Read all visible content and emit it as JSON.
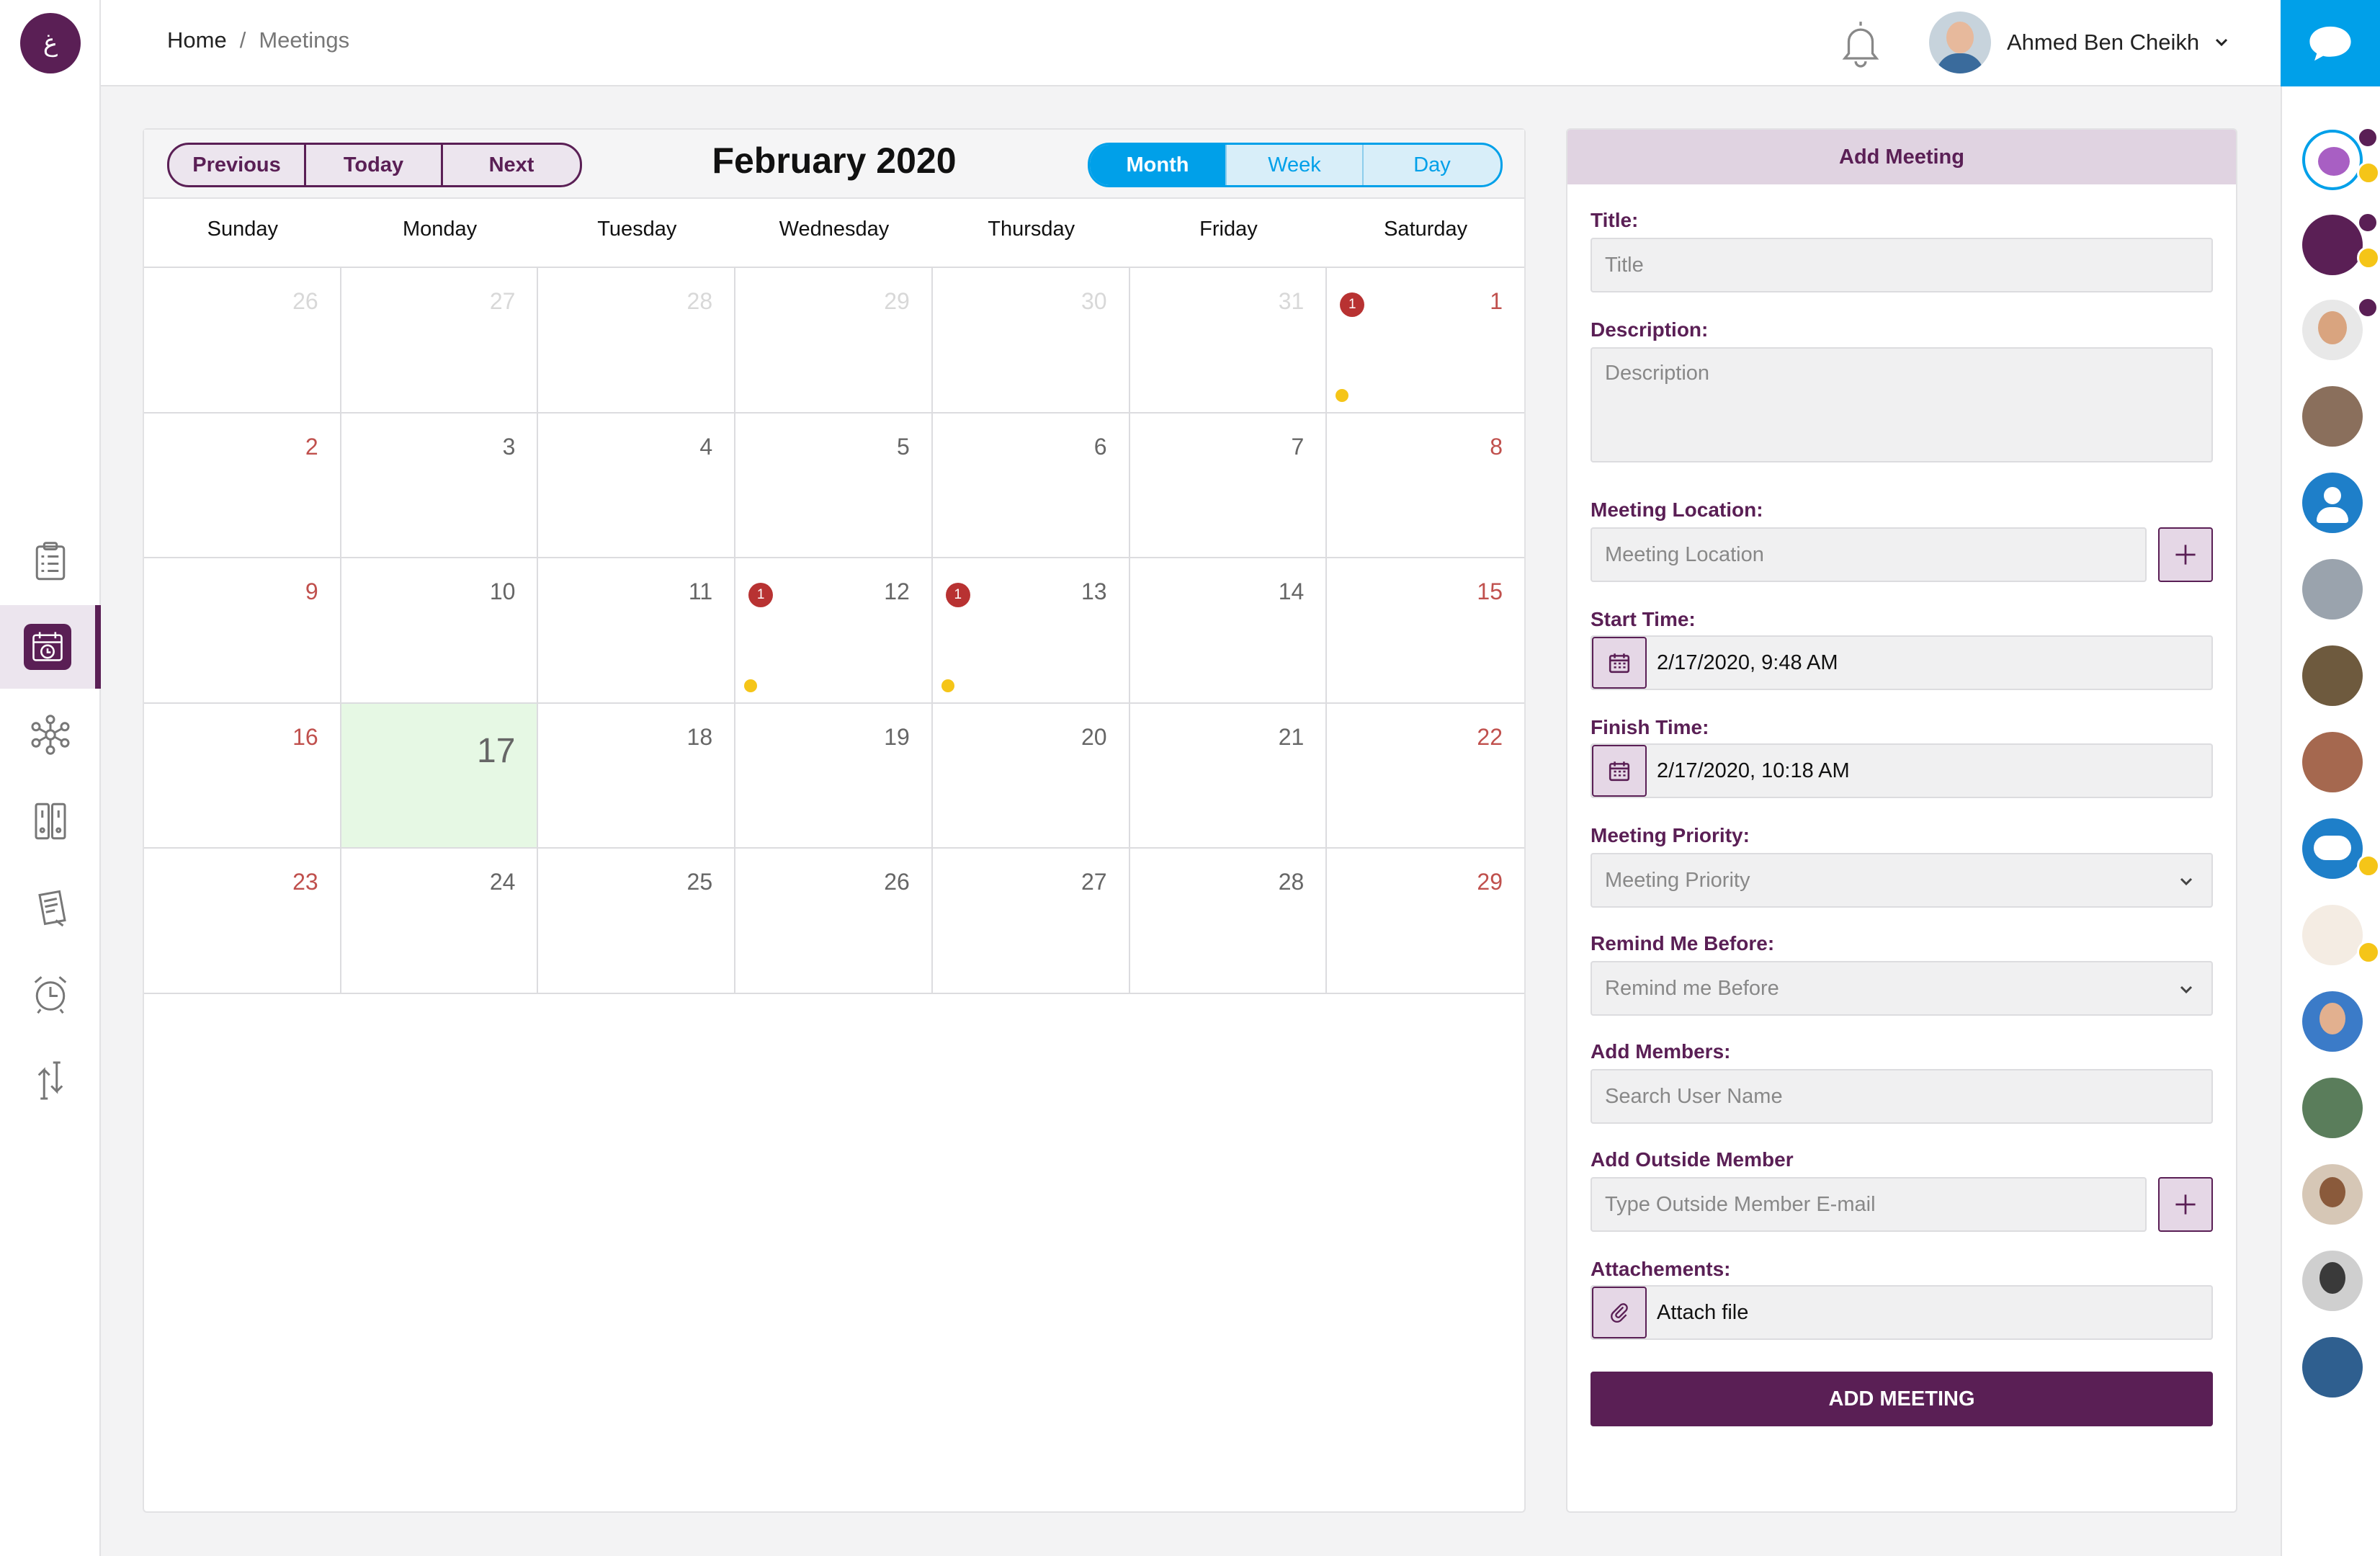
{
  "app": {
    "logo_glyph": "غ"
  },
  "breadcrumb": {
    "home": "Home",
    "separator": "/",
    "current": "Meetings"
  },
  "user": {
    "name": "Ahmed Ben Cheikh"
  },
  "sidebar": {
    "items": [
      {
        "icon": "checklist-icon"
      },
      {
        "icon": "calendar-clock-icon",
        "active": true
      },
      {
        "icon": "network-icon"
      },
      {
        "icon": "binders-icon"
      },
      {
        "icon": "notes-icon"
      },
      {
        "icon": "alarm-clock-icon"
      },
      {
        "icon": "transfer-arrows-icon"
      }
    ]
  },
  "calendar": {
    "title": "February 2020",
    "nav": {
      "previous": "Previous",
      "today": "Today",
      "next": "Next"
    },
    "views": {
      "month": "Month",
      "week": "Week",
      "day": "Day",
      "active": "Month"
    },
    "weekdays": [
      "Sunday",
      "Monday",
      "Tuesday",
      "Wednesday",
      "Thursday",
      "Friday",
      "Saturday"
    ],
    "days": [
      {
        "n": "26",
        "other": true
      },
      {
        "n": "27",
        "other": true
      },
      {
        "n": "28",
        "other": true
      },
      {
        "n": "29",
        "other": true
      },
      {
        "n": "30",
        "other": true
      },
      {
        "n": "31",
        "other": true
      },
      {
        "n": "1",
        "weekend": true,
        "events": "1"
      },
      {
        "n": "2",
        "weekend": true
      },
      {
        "n": "3"
      },
      {
        "n": "4"
      },
      {
        "n": "5"
      },
      {
        "n": "6"
      },
      {
        "n": "7"
      },
      {
        "n": "8",
        "weekend": true
      },
      {
        "n": "9",
        "weekend": true
      },
      {
        "n": "10"
      },
      {
        "n": "11"
      },
      {
        "n": "12",
        "events": "1"
      },
      {
        "n": "13",
        "events": "1"
      },
      {
        "n": "14"
      },
      {
        "n": "15",
        "weekend": true
      },
      {
        "n": "16",
        "weekend": true
      },
      {
        "n": "17",
        "today": true
      },
      {
        "n": "18"
      },
      {
        "n": "19"
      },
      {
        "n": "20"
      },
      {
        "n": "21"
      },
      {
        "n": "22",
        "weekend": true
      },
      {
        "n": "23",
        "weekend": true
      },
      {
        "n": "24"
      },
      {
        "n": "25"
      },
      {
        "n": "26"
      },
      {
        "n": "27"
      },
      {
        "n": "28"
      },
      {
        "n": "29",
        "weekend": true
      }
    ],
    "colors": {
      "event_badge": "#b83232",
      "event_dot": "#f5c518",
      "today_bg": "#e6f8e4",
      "weekend_text": "#c0504d"
    }
  },
  "form": {
    "header": "Add Meeting",
    "title_label": "Title:",
    "title_placeholder": "Title",
    "description_label": "Description:",
    "description_placeholder": "Description",
    "location_label": "Meeting Location:",
    "location_placeholder": "Meeting Location",
    "start_label": "Start Time:",
    "start_value": "2/17/2020, 9:48 AM",
    "finish_label": "Finish Time:",
    "finish_value": "2/17/2020, 10:18 AM",
    "priority_label": "Meeting Priority:",
    "priority_value": "Meeting Priority",
    "remind_label": "Remind Me Before:",
    "remind_value": "Remind me Before",
    "members_label": "Add Members:",
    "members_placeholder": "Search User Name",
    "outside_label": "Add Outside Member",
    "outside_placeholder": "Type Outside Member E-mail",
    "attach_label": "Attachements:",
    "attach_value": "Attach file",
    "submit": "ADD MEETING"
  },
  "theme": {
    "primary": "#5a1f55",
    "accent": "#00a0e9"
  }
}
